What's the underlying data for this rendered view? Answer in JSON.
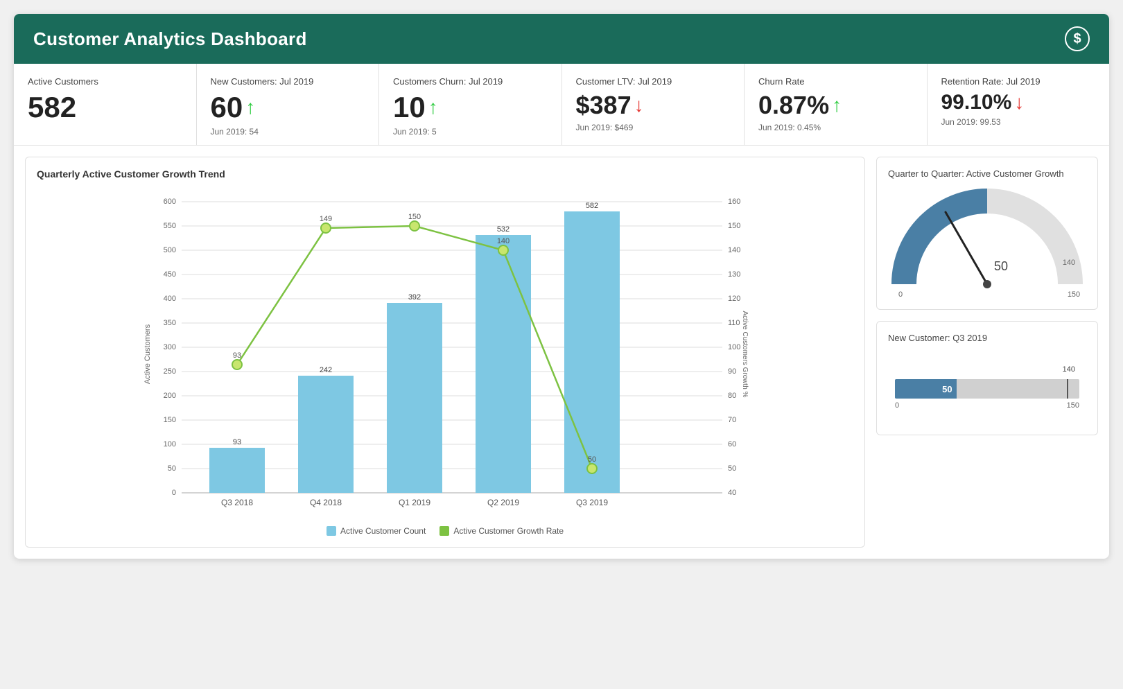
{
  "header": {
    "title": "Customer Analytics Dashboard",
    "icon": "S"
  },
  "kpis": [
    {
      "label": "Active Customers",
      "value": "582",
      "arrow": null,
      "sub": null
    },
    {
      "label": "New Customers: Jul 2019",
      "value": "60",
      "arrow": "up",
      "sub": "Jun 2019: 54"
    },
    {
      "label": "Customers Churn: Jul 2019",
      "value": "10",
      "arrow": "up",
      "sub": "Jun 2019: 5"
    },
    {
      "label": "Customer LTV: Jul 2019",
      "value": "$387",
      "arrow": "down",
      "sub": "Jun 2019: $469"
    },
    {
      "label": "Churn Rate",
      "value": "0.87%",
      "arrow": "up",
      "sub": "Jun 2019: 0.45%"
    },
    {
      "label": "Retention Rate: Jul 2019",
      "value": "99.10%",
      "arrow": "down",
      "sub": "Jun 2019: 99.53"
    }
  ],
  "bar_chart": {
    "title": "Quarterly Active Customer Growth Trend",
    "bars": [
      {
        "label": "Q3 2018",
        "value": 93,
        "growth": 93
      },
      {
        "label": "Q4 2018",
        "value": 242,
        "growth": 149
      },
      {
        "label": "Q1 2019",
        "value": 392,
        "growth": 150
      },
      {
        "label": "Q2 2019",
        "value": 532,
        "growth": 140
      },
      {
        "label": "Q3 2019",
        "value": 582,
        "growth": 50
      }
    ],
    "y_max": 650,
    "y_labels": [
      0,
      50,
      100,
      150,
      200,
      250,
      300,
      350,
      400,
      450,
      500,
      550,
      600
    ],
    "y2_labels": [
      40,
      50,
      60,
      70,
      80,
      90,
      100,
      110,
      120,
      130,
      140,
      150,
      160
    ],
    "legend": {
      "bar_label": "Active Customer Count",
      "line_label": "Active Customer Growth Rate"
    }
  },
  "gauge": {
    "title": "Quarter to Quarter: Active Customer Growth",
    "value": 50,
    "min": 0,
    "max": 150,
    "target": 140,
    "needle_angle": 50
  },
  "bullet": {
    "title": "New Customer: Q3 2019",
    "value": 50,
    "max_display": 150,
    "target": 140,
    "min": 0
  }
}
